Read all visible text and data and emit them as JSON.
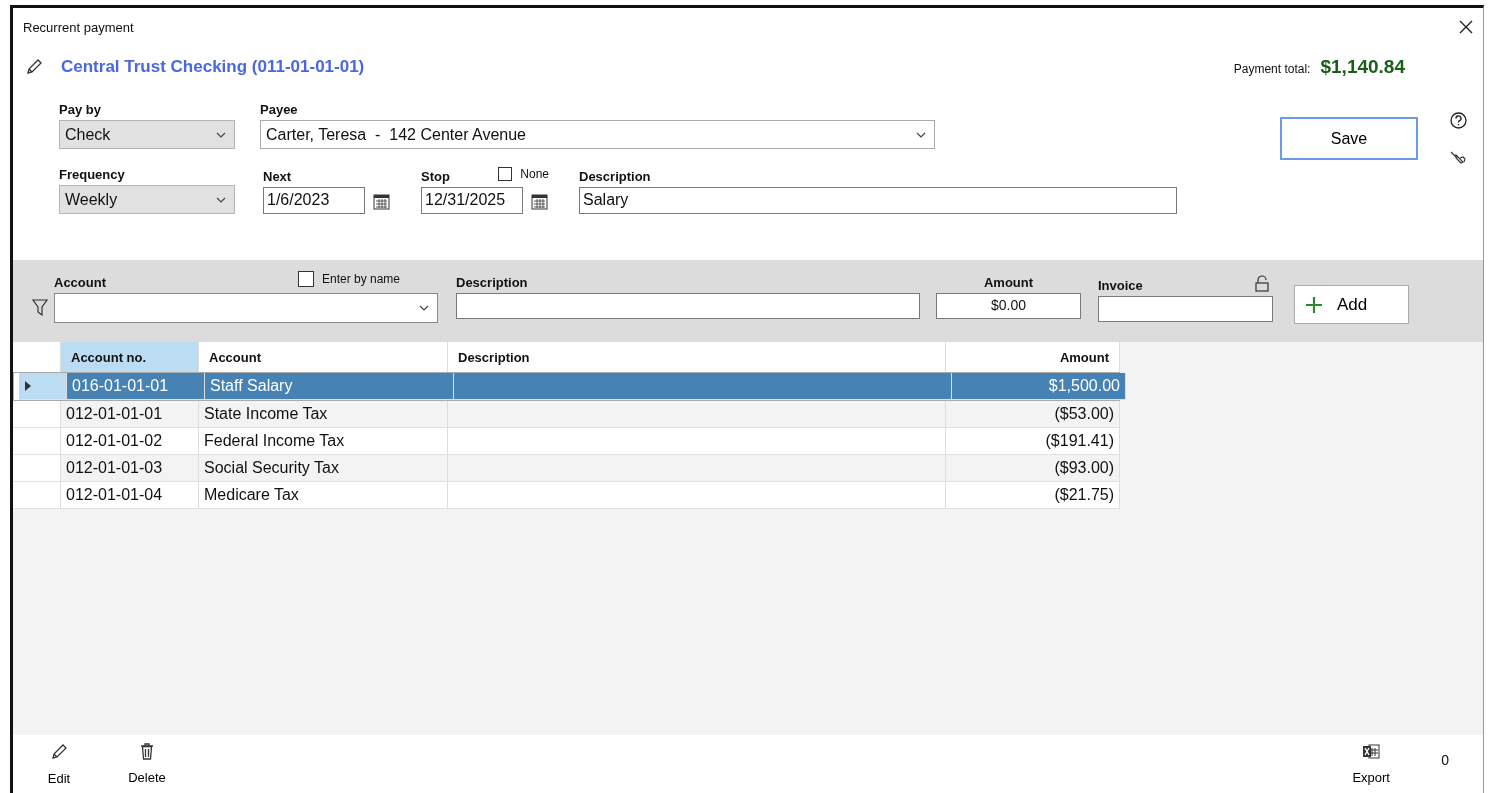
{
  "window": {
    "title": "Recurrent payment"
  },
  "account_title": "Central Trust Checking (011-01-01-01)",
  "payment_total": {
    "label": "Payment total:",
    "value": "$1,140.84"
  },
  "form": {
    "pay_by": {
      "label": "Pay by",
      "value": "Check"
    },
    "payee": {
      "label": "Payee",
      "value": "Carter, Teresa  -  142 Center Avenue"
    },
    "frequency": {
      "label": "Frequency",
      "value": "Weekly"
    },
    "next": {
      "label": "Next",
      "value": "1/6/2023"
    },
    "stop": {
      "label": "Stop",
      "value": "12/31/2025"
    },
    "none": {
      "label": "None",
      "checked": false
    },
    "description": {
      "label": "Description",
      "value": "Salary"
    }
  },
  "save_button": "Save",
  "entry": {
    "account": {
      "label": "Account"
    },
    "enter_by_name": {
      "label": "Enter by name",
      "checked": false
    },
    "description": {
      "label": "Description"
    },
    "amount": {
      "label": "Amount",
      "value": "$0.00"
    },
    "invoice": {
      "label": "Invoice"
    },
    "add_button": "Add"
  },
  "table": {
    "columns": [
      {
        "label": "Account no.",
        "highlighted": true
      },
      {
        "label": "Account",
        "highlighted": false
      },
      {
        "label": "Description",
        "highlighted": false
      },
      {
        "label": "Amount",
        "highlighted": false
      }
    ],
    "rows": [
      {
        "account_no": "016-01-01-01",
        "account": "Staff Salary",
        "amount": "$1,500.00",
        "selected": true
      },
      {
        "account_no": "012-01-01-01",
        "account": "State Income Tax",
        "amount": "($53.00)",
        "selected": false
      },
      {
        "account_no": "012-01-01-02",
        "account": "Federal Income Tax",
        "amount": "($191.41)",
        "selected": false
      },
      {
        "account_no": "012-01-01-03",
        "account": "Social Security Tax",
        "amount": "($93.00)",
        "selected": false
      },
      {
        "account_no": "012-01-01-04",
        "account": "Medicare Tax",
        "amount": "($21.75)",
        "selected": false
      }
    ]
  },
  "toolbar": [
    {
      "label": "Edit",
      "kind": "edit"
    },
    {
      "label": "Delete",
      "kind": "delete"
    },
    {
      "label": "Export",
      "kind": "export"
    }
  ],
  "count": "0"
}
